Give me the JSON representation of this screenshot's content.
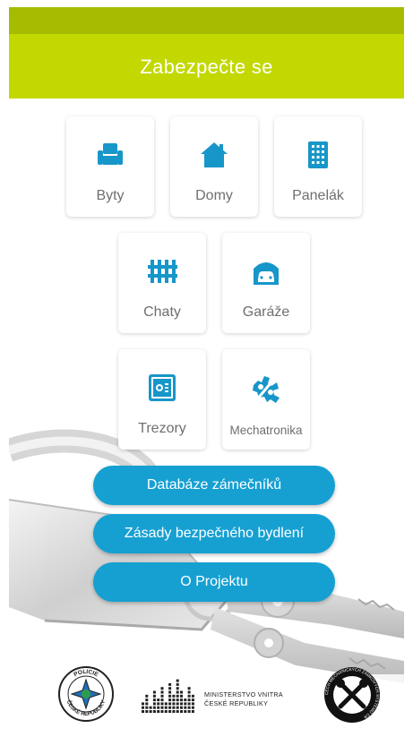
{
  "header": {
    "title": "Zabezpečte se"
  },
  "tiles": [
    {
      "label": "Byty",
      "icon": "armchair-icon"
    },
    {
      "label": "Domy",
      "icon": "house-icon"
    },
    {
      "label": "Panelák",
      "icon": "apartment-building-icon"
    },
    {
      "label": "Chaty",
      "icon": "fence-icon"
    },
    {
      "label": "Garáže",
      "icon": "garage-icon"
    },
    {
      "label": "Trezory",
      "icon": "safe-icon"
    },
    {
      "label": "Mechatronika",
      "icon": "gears-icon"
    }
  ],
  "buttons": [
    {
      "label": "Databáze zámečníků"
    },
    {
      "label": "Zásady bezpečného bydlení"
    },
    {
      "label": "O Projektu"
    }
  ],
  "footer": {
    "police_logo_text": [
      "POLICIE",
      "ČESKÉ REPUBLIKY"
    ],
    "ministry_line1": "MINISTERSTVO VNITRA",
    "ministry_line2": "ČESKÉ REPUBLIKY",
    "locksmith_logo_text": "CECH MECHANICKÝCH ZÁMKOVÝCH SYSTÉMŮ ČR"
  },
  "colors": {
    "accent_green": "#c2d800",
    "status_green": "#a5bc00",
    "icon_blue": "#1796c9",
    "button_blue": "#16a0d2",
    "tile_text": "#6f6f6f"
  }
}
